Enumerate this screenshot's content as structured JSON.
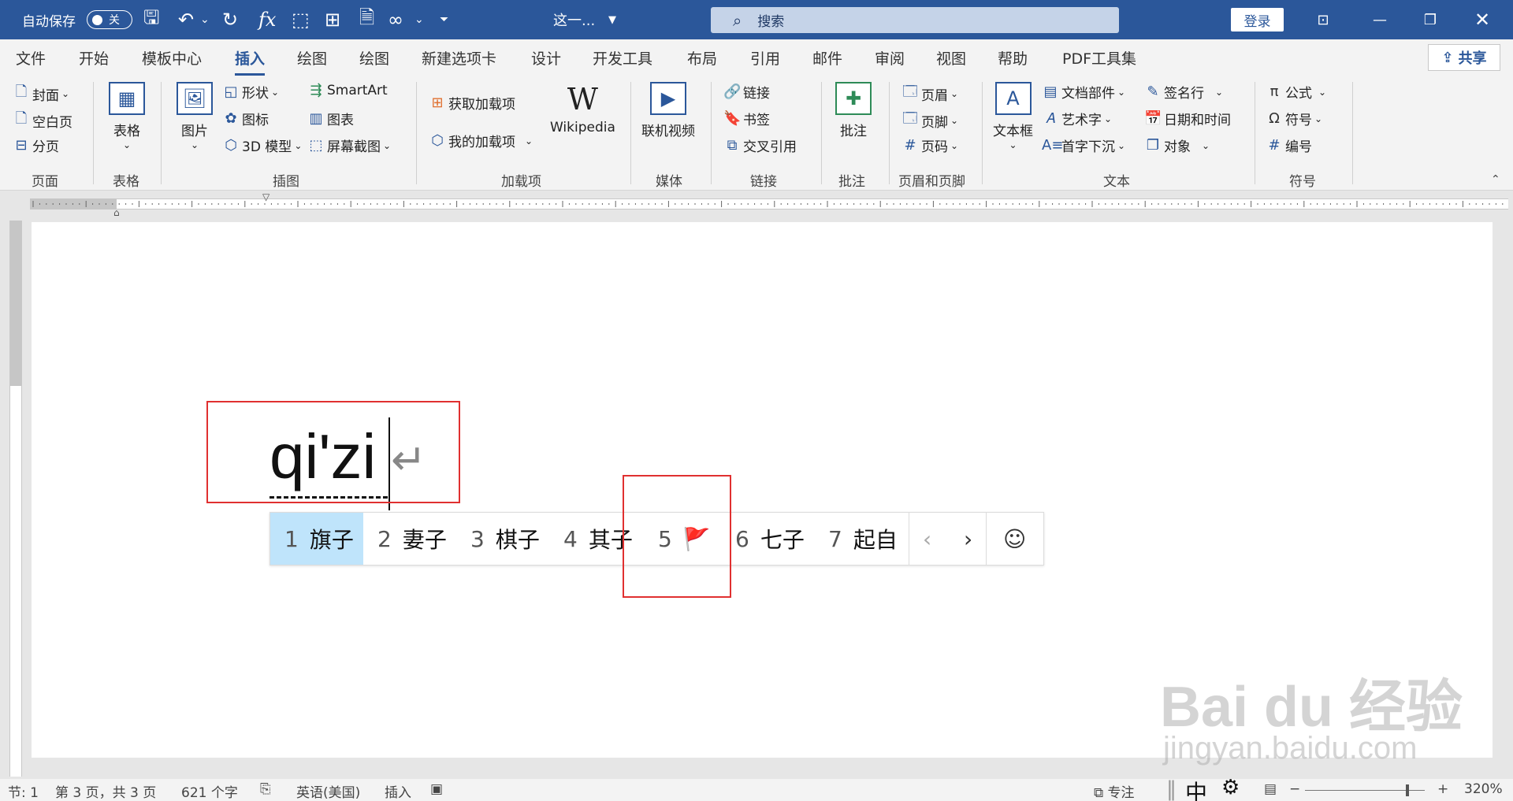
{
  "titlebar": {
    "autosave_label": "自动保存",
    "autosave_state": "关",
    "doc_title": "这一...",
    "search_placeholder": "搜索",
    "login_label": "登录",
    "qat_icons": [
      "save-icon",
      "undo-icon",
      "redo-icon",
      "fx-icon",
      "select-icon",
      "org-chart-icon",
      "doc-icon",
      "infinity-icon",
      "customize-icon"
    ]
  },
  "tabs": [
    "文件",
    "开始",
    "模板中心",
    "插入",
    "绘图",
    "绘图",
    "新建选项卡",
    "设计",
    "开发工具",
    "布局",
    "引用",
    "邮件",
    "审阅",
    "视图",
    "帮助",
    "PDF工具集"
  ],
  "active_tab": "插入",
  "share_label": "共享",
  "ribbon": {
    "page_group": {
      "label": "页面",
      "items": [
        "封面",
        "空白页",
        "分页"
      ]
    },
    "table_group": {
      "label": "表格",
      "button": "表格"
    },
    "illustrations_group": {
      "label": "插图",
      "picture": "图片",
      "items": [
        "形状",
        "图标",
        "3D 模型",
        "SmartArt",
        "图表",
        "屏幕截图"
      ]
    },
    "addins_group": {
      "label": "加载项",
      "items": [
        "获取加载项",
        "我的加载项"
      ],
      "wikipedia": "Wikipedia"
    },
    "media_group": {
      "label": "媒体",
      "button": "联机视频"
    },
    "links_group": {
      "label": "链接",
      "items": [
        "链接",
        "书签",
        "交叉引用"
      ]
    },
    "comments_group": {
      "label": "批注",
      "button": "批注"
    },
    "header_footer_group": {
      "label": "页眉和页脚",
      "items": [
        "页眉",
        "页脚",
        "页码"
      ]
    },
    "text_group": {
      "label": "文本",
      "textbox": "文本框",
      "items": [
        "文档部件",
        "艺术字",
        "首字下沉",
        "签名行",
        "日期和时间",
        "对象"
      ]
    },
    "symbols_group": {
      "label": "符号",
      "items": [
        "公式",
        "符号",
        "编号"
      ]
    }
  },
  "document": {
    "typed_text": "qi'zi"
  },
  "ime": {
    "candidates": [
      {
        "num": "1",
        "text": "旗子"
      },
      {
        "num": "2",
        "text": "妻子"
      },
      {
        "num": "3",
        "text": "棋子"
      },
      {
        "num": "4",
        "text": "其子"
      },
      {
        "num": "5",
        "text": "🚩"
      },
      {
        "num": "6",
        "text": "七子"
      },
      {
        "num": "7",
        "text": "起自"
      }
    ],
    "prev": "‹",
    "next": "›",
    "emoji": "☺"
  },
  "watermark": {
    "main": "Bai du 经验",
    "sub": "jingyan.baidu.com"
  },
  "status": {
    "section": "节: 1",
    "page": "第 3 页，共 3 页",
    "words": "621 个字",
    "language": "英语(美国)",
    "mode": "插入",
    "focus": "专注",
    "ime_mode": "中",
    "zoom": "320%"
  },
  "colors": {
    "accent": "#2b579a",
    "highlight_box": "#e03030",
    "selected_candidate": "#bfe4fb"
  }
}
